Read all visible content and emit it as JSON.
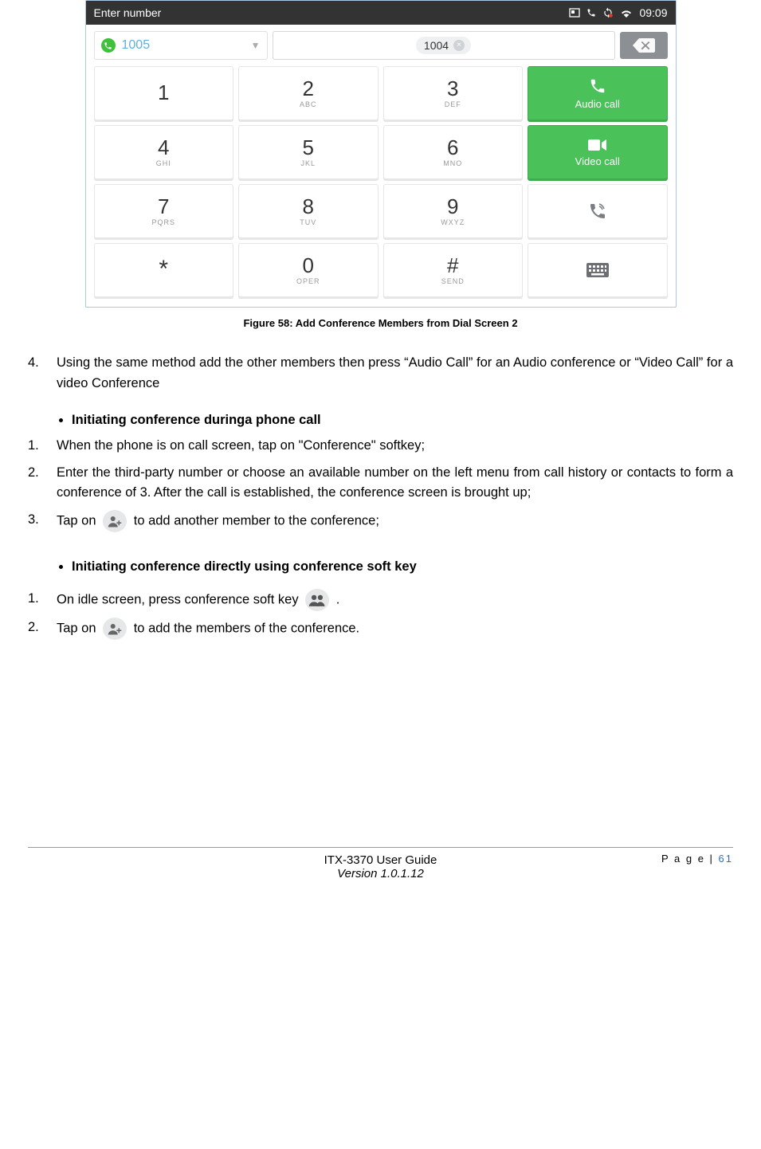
{
  "screenshot": {
    "status_bar": {
      "title": "Enter number",
      "time": "09:09"
    },
    "account": {
      "number": "1005"
    },
    "input_chip": "1004",
    "keypad": [
      {
        "num": "1",
        "sub": ""
      },
      {
        "num": "2",
        "sub": "ABC"
      },
      {
        "num": "3",
        "sub": "DEF"
      },
      {
        "num": "4",
        "sub": "GHI"
      },
      {
        "num": "5",
        "sub": "JKL"
      },
      {
        "num": "6",
        "sub": "MNO"
      },
      {
        "num": "7",
        "sub": "PQRS"
      },
      {
        "num": "8",
        "sub": "TUV"
      },
      {
        "num": "9",
        "sub": "WXYZ"
      },
      {
        "num": "*",
        "sub": ""
      },
      {
        "num": "0",
        "sub": "OPER"
      },
      {
        "num": "#",
        "sub": "SEND"
      }
    ],
    "actions": {
      "audio": "Audio call",
      "video": "Video call"
    }
  },
  "caption": "Figure 58: Add Conference Members from Dial Screen 2",
  "step4": {
    "marker": "4.",
    "text": "Using the same method add the other members then press “Audio Call” for an Audio conference or “Video Call” for a video Conference"
  },
  "section1": {
    "heading": "Initiating conference duringa phone call",
    "step1": {
      "marker": "1.",
      "text": "When the phone is on call screen, tap on \"Conference\" softkey;"
    },
    "step2": {
      "marker": "2.",
      "text": "Enter the third-party number or choose an available number on the left menu from call history or contacts to form a conference of 3. After the call is established, the conference screen is brought up;"
    },
    "step3": {
      "marker": "3.",
      "pre": "Tap on",
      "post": " to add another member to the conference;"
    }
  },
  "section2": {
    "heading": "Initiating conference directly using conference soft key",
    "step1": {
      "marker": "1.",
      "pre": "On idle screen, press conference soft key ",
      "post": "."
    },
    "step2": {
      "marker": "2.",
      "pre": " Tap on ",
      "post": " to add the members of the conference."
    }
  },
  "footer": {
    "page_label": "P a g e | ",
    "page_num": "61",
    "guide": "ITX-3370 User Guide",
    "version": "Version 1.0.1.12"
  }
}
